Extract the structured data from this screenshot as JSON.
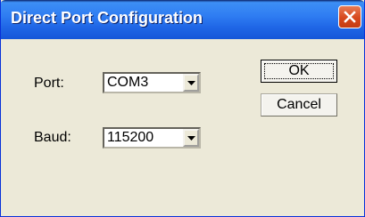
{
  "window": {
    "title": "Direct Port Configuration",
    "close_icon": "close-x-icon"
  },
  "form": {
    "port_label": "Port:",
    "port_value": "COM3",
    "baud_label": "Baud:",
    "baud_value": "115200",
    "dropdown_icon": "chevron-down-icon"
  },
  "buttons": {
    "ok_label": "OK",
    "cancel_label": "Cancel"
  },
  "colors": {
    "titlebar": "#2f7df2",
    "window_bg": "#ece9d8",
    "close_button": "#d7481c"
  }
}
